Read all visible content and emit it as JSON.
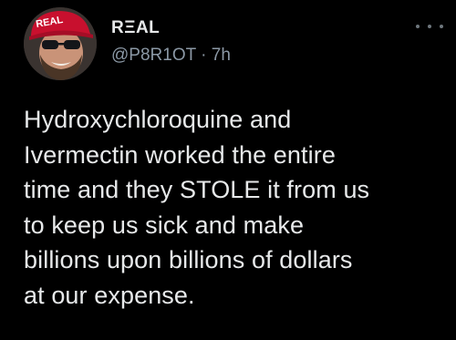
{
  "tweet": {
    "author": {
      "display_name": "RΞAL",
      "handle": "@P8R1OT",
      "separator": " · ",
      "time_ago": "7h",
      "avatar_hat_text": "REAL"
    },
    "text_lines": [
      "Hydroxychloroquine and",
      "Ivermectin worked the entire",
      "time and they STOLE it from us",
      "to keep us sick and make",
      "billions upon billions of dollars",
      "at our expense."
    ]
  },
  "colors": {
    "background": "#000000",
    "text_primary": "#e7e9ea",
    "text_secondary": "#8b98a5",
    "hat_red": "#c8102e"
  },
  "icons": {
    "more": "more-horizontal-icon"
  }
}
